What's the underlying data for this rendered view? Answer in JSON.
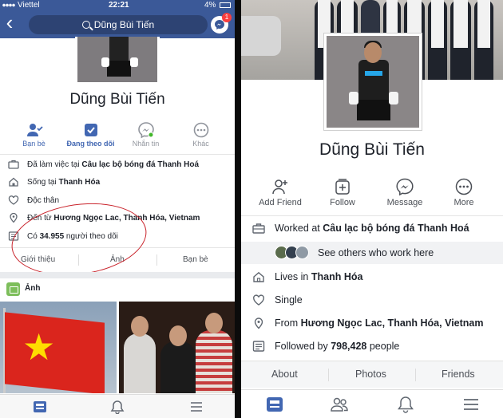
{
  "colors": {
    "brand": "#3b5998",
    "link": "#4267b2",
    "annotation": "#c9232b",
    "badge": "#fa3e3e"
  },
  "left": {
    "status": {
      "carrier": "Viettel",
      "time": "22:21",
      "battery": "4%"
    },
    "search": {
      "label": "Dũng Bùi Tiến"
    },
    "messenger_badge": "1",
    "profile_name": "Dũng Bùi Tiến",
    "actions": [
      {
        "label": "Bạn bè",
        "icon": "friends-icon"
      },
      {
        "label": "Đang theo dõi",
        "icon": "following-icon"
      },
      {
        "label": "Nhắn tin",
        "icon": "messenger-icon"
      },
      {
        "label": "Khác",
        "icon": "more-icon"
      }
    ],
    "info": {
      "work_prefix": "Đã làm việc tại ",
      "work_place": "Câu lạc bộ bóng đá Thanh Hoá",
      "lives_prefix": "Sống tại ",
      "lives_place": "Thanh Hóa",
      "relationship": "Độc thân",
      "from_prefix": "Đến từ ",
      "from_place": "Hương Ngọc Lac, Thanh Hóa, Vietnam",
      "followers_prefix": "Có ",
      "followers_count": "34.955",
      "followers_suffix": " người theo dõi"
    },
    "tabs": [
      "Giới thiệu",
      "Ảnh",
      "Bạn bè"
    ],
    "photos_title": "Ảnh"
  },
  "right": {
    "profile_name": "Dũng Bùi Tiến",
    "actions": [
      {
        "label": "Add Friend",
        "icon": "add-friend-icon"
      },
      {
        "label": "Follow",
        "icon": "follow-icon"
      },
      {
        "label": "Message",
        "icon": "messenger-icon"
      },
      {
        "label": "More",
        "icon": "more-icon"
      }
    ],
    "info": {
      "work_prefix": "Worked at ",
      "work_place": "Câu lạc bộ bóng đá Thanh Hoá",
      "see_others": "See others who work here",
      "lives_prefix": "Lives in ",
      "lives_place": "Thanh Hóa",
      "relationship": "Single",
      "from_prefix": "From ",
      "from_place": "Hương Ngọc Lac, Thanh Hóa, Vietnam",
      "followers_prefix": "Followed by ",
      "followers_count": "798,428",
      "followers_suffix": " people"
    },
    "tabs": [
      "About",
      "Photos",
      "Friends"
    ]
  }
}
